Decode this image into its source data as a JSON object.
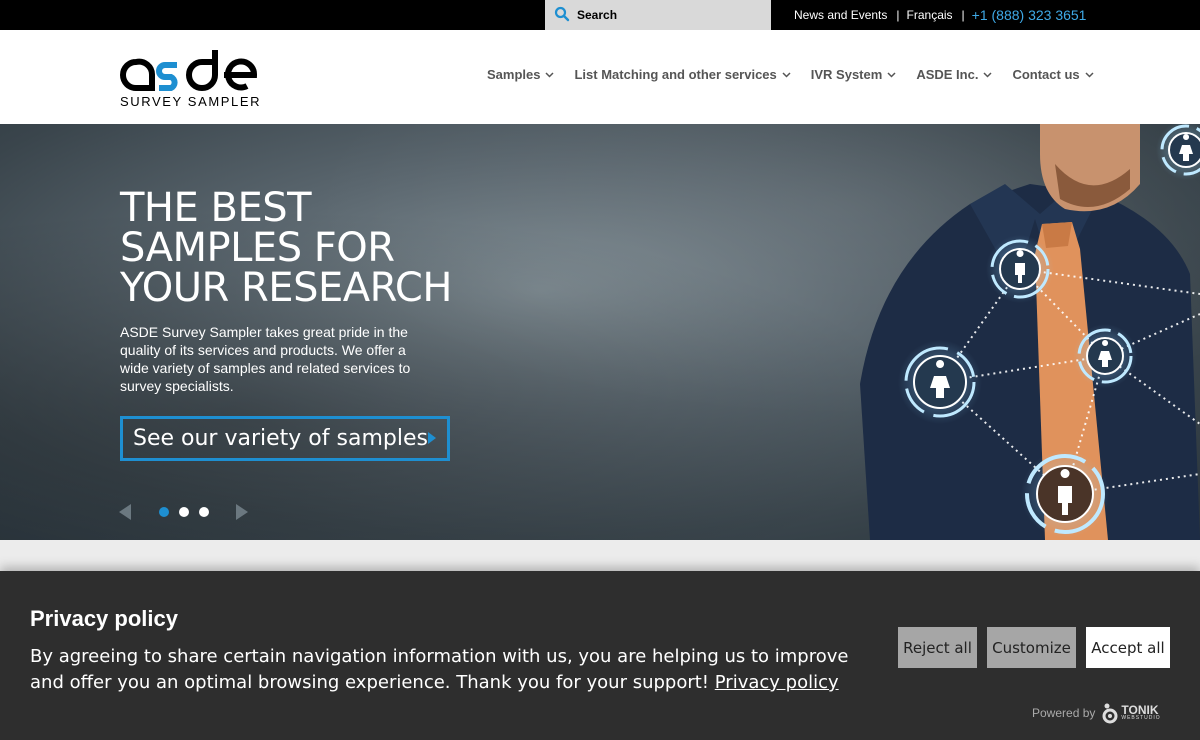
{
  "topbar": {
    "search_placeholder": "Search",
    "news": "News and Events",
    "sep": "|",
    "lang": "Français",
    "phone": "+1 (888) 323 3651"
  },
  "logo": {
    "text": "asde",
    "tagline": "SURVEY SAMPLER"
  },
  "nav": [
    "Samples",
    "List Matching and other services",
    "IVR System",
    "ASDE Inc.",
    "Contact us"
  ],
  "hero": {
    "title": "THE BEST SAMPLES FOR YOUR RESEARCH",
    "body": "ASDE Survey Sampler takes great pride in the quality of its services and products. We offer a wide variety of samples and related services to survey specialists.",
    "cta": "See our variety of samples",
    "slides": 3,
    "active_slide": 1
  },
  "cookie": {
    "title": "Privacy policy",
    "message": "By agreeing to share certain navigation information with us, you are helping us to improve and offer you an optimal browsing experience. Thank you for your support! ",
    "link": "Privacy policy",
    "reject": "Reject all",
    "customize": "Customize",
    "accept": "Accept all",
    "powered_by": "Powered by",
    "vendor": "TONIK",
    "vendor_sub": "WEBSTUDIO"
  },
  "colors": {
    "accent": "#1e8fd1",
    "phone": "#3fa9e6",
    "banner": "#2e2e2e"
  }
}
